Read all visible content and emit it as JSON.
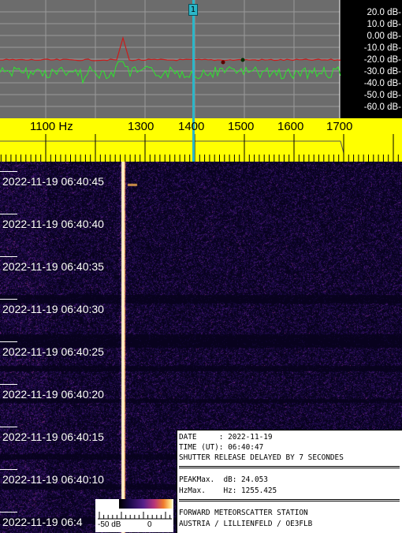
{
  "spectrum": {
    "db_labels": [
      "20.0 dB-",
      "10.0 dB-",
      "0.00 dB-",
      "-10.0 dB-",
      "-20.0 dB-",
      "-30.0 dB-",
      "-40.0 dB-",
      "-50.0 dB-",
      "-60.0 dB-"
    ],
    "marker_label": "1",
    "colors": {
      "background": "#6c6c6c",
      "green_trace": "#2ee52e",
      "red_trace": "#cc1a1a",
      "marker": "#2bb6c8",
      "label_panel": "#000000"
    }
  },
  "ruler": {
    "freq_labels": [
      "1100 Hz",
      "1300",
      "1400",
      "1500",
      "1600",
      "1700"
    ],
    "colors": {
      "background": "#ffff00"
    }
  },
  "waterfall": {
    "timestamps": [
      "2022-11-19 06:40:45",
      "2022-11-19 06:40:40",
      "2022-11-19 06:40:35",
      "2022-11-19 06:40:30",
      "2022-11-19 06:40:25",
      "2022-11-19 06:40:20",
      "2022-11-19 06:40:15",
      "2022-11-19 06:40:10",
      "2022-11-19 06:4"
    ]
  },
  "info": {
    "line1": "DATE     : 2022-11-19",
    "line2": "TIME (UT): 06:40:47",
    "line3": "SHUTTER RELEASE DELAYED BY 7 SECONDES",
    "line4": "PEAKMax.  dB: 24.053",
    "line5": "HzMax.    Hz: 1255.425",
    "line6": "FORWARD METEORSCATTER STATION",
    "line7": "AUSTRIA / LILLIENFELD / OE3FLB"
  },
  "scale": {
    "min_label": "-50 dB",
    "max_label": "0"
  }
}
